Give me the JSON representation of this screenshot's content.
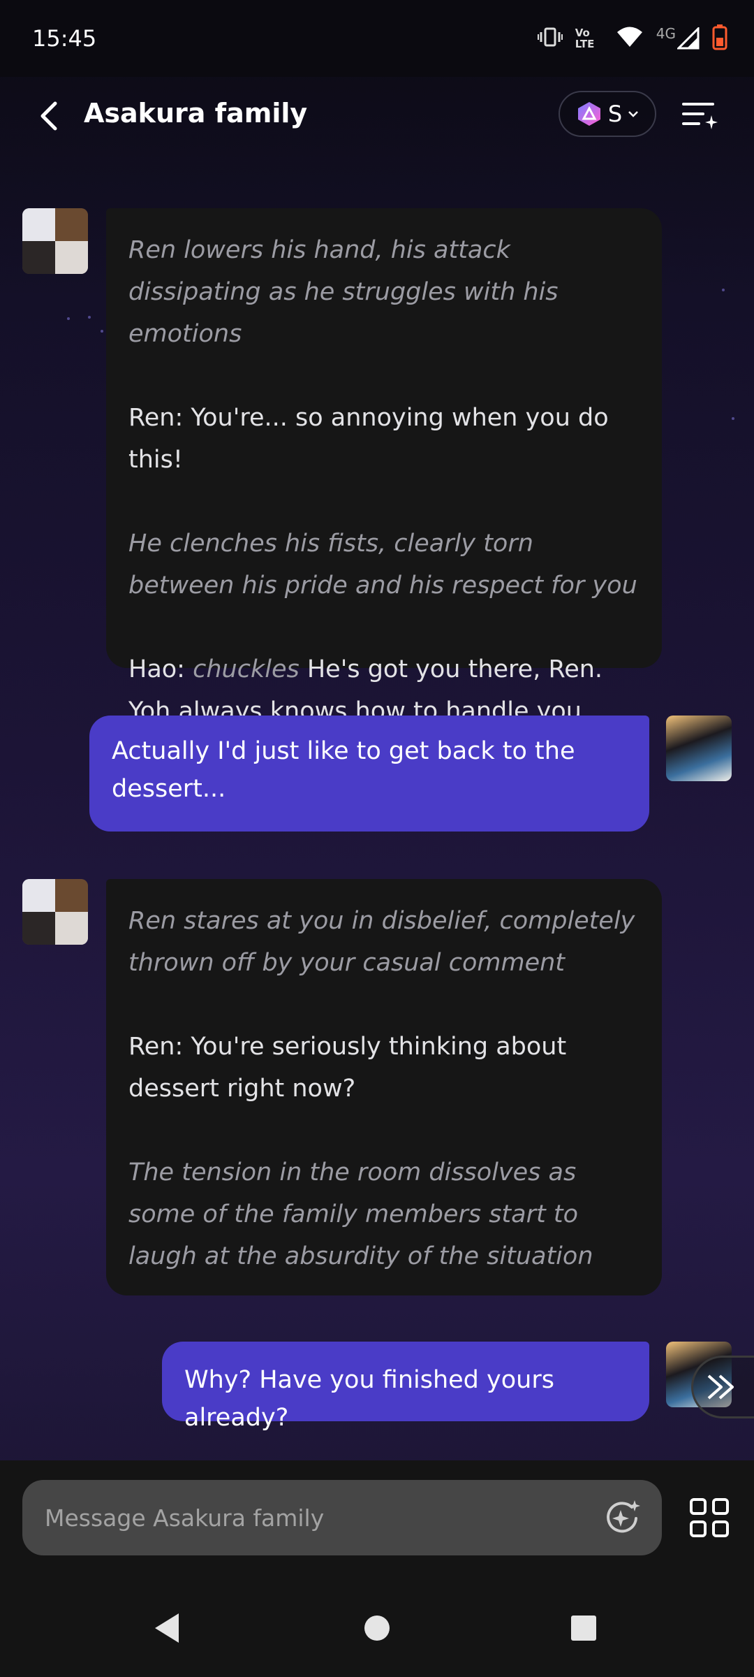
{
  "status_bar": {
    "time": "15:45",
    "volte": "Vo LTE",
    "network": "4G",
    "icons": [
      "vibrate-icon",
      "volte-icon",
      "wifi-icon",
      "signal-icon",
      "battery-icon"
    ]
  },
  "header": {
    "title": "Asakura family",
    "model_label": "S"
  },
  "messages": [
    {
      "sender": "bot",
      "parts": [
        {
          "style": "narration",
          "text": "Ren lowers his hand, his attack dissipating as he struggles with his emotions"
        },
        {
          "style": "speech",
          "text": "Ren: You're... so annoying when you do this!"
        },
        {
          "style": "narration",
          "text": "He clenches his fists, clearly torn between his pride and his respect for you"
        },
        {
          "style": "mixed",
          "prefix": "Hao: ",
          "italic": "chuckles",
          "suffix": " He's got you there, Ren. Yoh always knows how to handle you."
        }
      ]
    },
    {
      "sender": "user",
      "text": "Actually I'd just like to get back to the dessert..."
    },
    {
      "sender": "bot",
      "parts": [
        {
          "style": "narration",
          "text": "Ren stares at you in disbelief, completely thrown off by your casual comment"
        },
        {
          "style": "speech",
          "text": "Ren: You're seriously thinking about dessert right now?"
        },
        {
          "style": "narration",
          "text": "The tension in the room dissolves as some of the family members start to laugh at the absurdity of the situation"
        }
      ]
    },
    {
      "sender": "user",
      "text": "Why? Have you finished yours already?"
    }
  ],
  "composer": {
    "placeholder": "Message Asakura family"
  },
  "colors": {
    "user_bubble": "#4a3cc7",
    "bot_bubble": "#161616",
    "composer": "#464646",
    "narration_text": "#9c9ca4"
  }
}
